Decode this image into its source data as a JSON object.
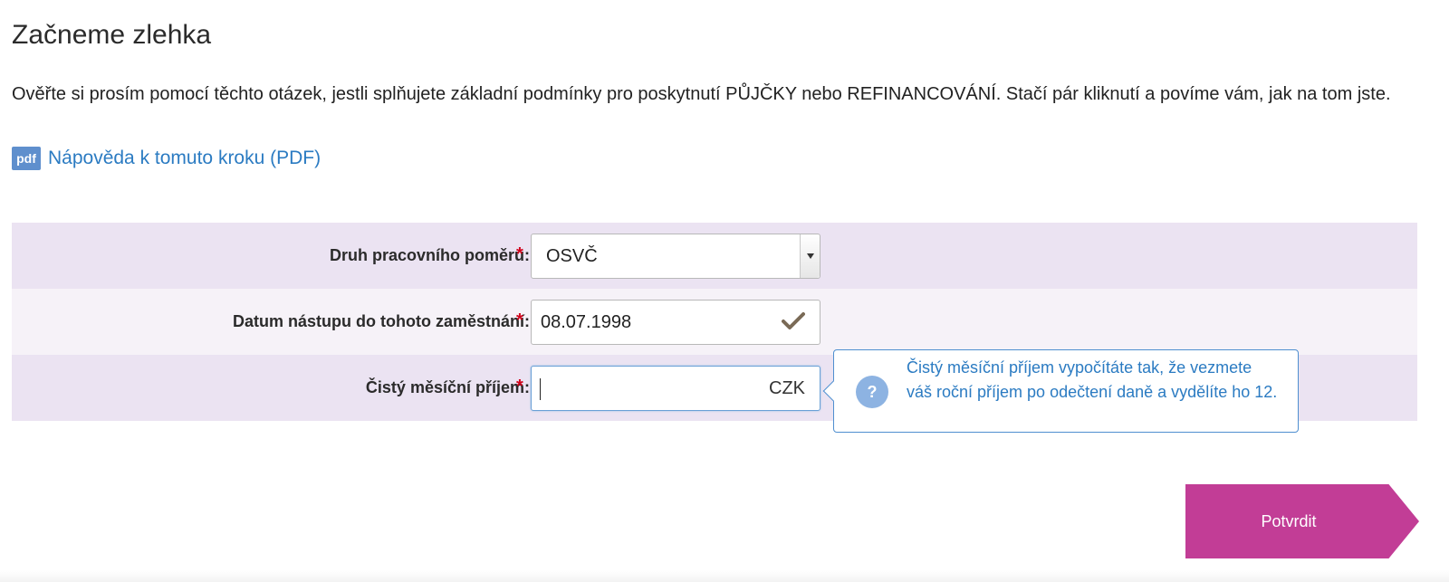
{
  "page": {
    "title": "Začneme zlehka",
    "intro": "Ověřte si prosím pomocí těchto otázek, jestli splňujete základní podmínky pro poskytnutí PŮJČKY nebo REFINANCOVÁNÍ. Stačí pár kliknutí a povíme vám, jak na tom jste.",
    "help_link": {
      "badge": "pdf",
      "label": "Nápověda k tomuto kroku (PDF)"
    }
  },
  "form": {
    "required_marker": "*",
    "employment_type": {
      "label": "Druh pracovního poměru:",
      "selected": "OSVČ"
    },
    "start_date": {
      "label": "Datum nástupu do tohoto zaměstnání:",
      "value": "08.07.1998",
      "status_icon": "check-icon"
    },
    "net_income": {
      "label": "Čistý měsíční příjem:",
      "value": "",
      "currency": "CZK"
    }
  },
  "tooltip": {
    "icon": "question-icon",
    "text": "Čistý měsíční příjem vypočítáte tak, že vezmete váš roční příjem po odečtení daně a vydělíte ho 12."
  },
  "actions": {
    "confirm_label": "Potvrdit"
  },
  "colors": {
    "accent": "#c23d96",
    "link": "#2b7bc2",
    "row_shaded": "#ebe3f2",
    "row_plain": "#f6f2f8",
    "tooltip_border": "#4f8fd0"
  }
}
